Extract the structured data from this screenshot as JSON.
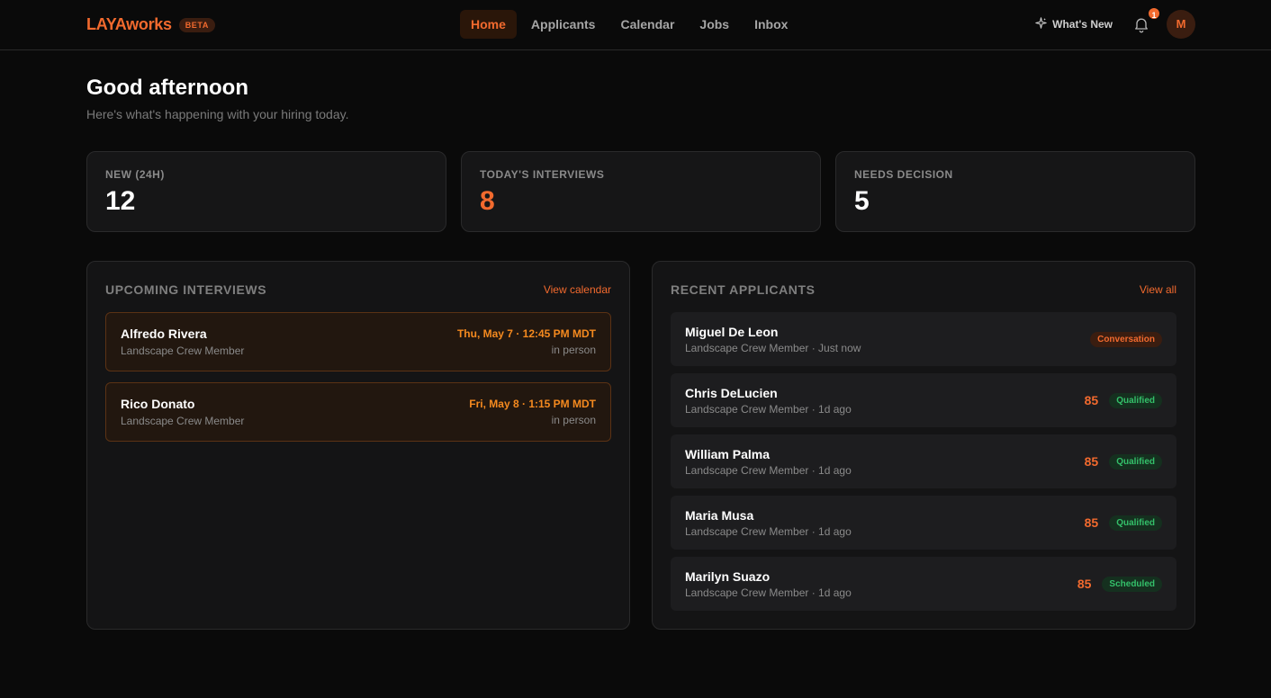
{
  "header": {
    "brand": "LAYAworks",
    "badge": "BETA",
    "nav": [
      "Home",
      "Applicants",
      "Calendar",
      "Jobs",
      "Inbox"
    ],
    "active_nav": "Home",
    "whats_new": "What's New",
    "notif_count": "1",
    "avatar_initial": "M"
  },
  "greeting": {
    "title": "Good afternoon",
    "subtitle": "Here's what's happening with your hiring today."
  },
  "stats": [
    {
      "label": "NEW (24H)",
      "value": "12"
    },
    {
      "label": "TODAY'S INTERVIEWS",
      "value": "8"
    },
    {
      "label": "NEEDS DECISION",
      "value": "5"
    }
  ],
  "interviews": {
    "title": "UPCOMING INTERVIEWS",
    "link": "View calendar",
    "items": [
      {
        "name": "Alfredo Rivera",
        "role": "Landscape Crew Member",
        "when": "Thu, May 7 · 12:45 PM MDT",
        "mode": "in person"
      },
      {
        "name": "Rico Donato",
        "role": "Landscape Crew Member",
        "when": "Fri, May 8 · 1:15 PM MDT",
        "mode": "in person"
      }
    ]
  },
  "applicants": {
    "title": "RECENT APPLICANTS",
    "link": "View all",
    "items": [
      {
        "name": "Miguel De Leon",
        "meta": "Landscape Crew Member · Just now",
        "score": "",
        "status": "Conversation"
      },
      {
        "name": "Chris DeLucien",
        "meta": "Landscape Crew Member · 1d ago",
        "score": "85",
        "status": "Qualified"
      },
      {
        "name": "William Palma",
        "meta": "Landscape Crew Member · 1d ago",
        "score": "85",
        "status": "Qualified"
      },
      {
        "name": "Maria Musa",
        "meta": "Landscape Crew Member · 1d ago",
        "score": "85",
        "status": "Qualified"
      },
      {
        "name": "Marilyn Suazo",
        "meta": "Landscape Crew Member · 1d ago",
        "score": "85",
        "status": "Scheduled"
      }
    ]
  },
  "colors": {
    "accent": "#f26a2e",
    "background": "#0a0a0a",
    "success": "#34c06a"
  }
}
